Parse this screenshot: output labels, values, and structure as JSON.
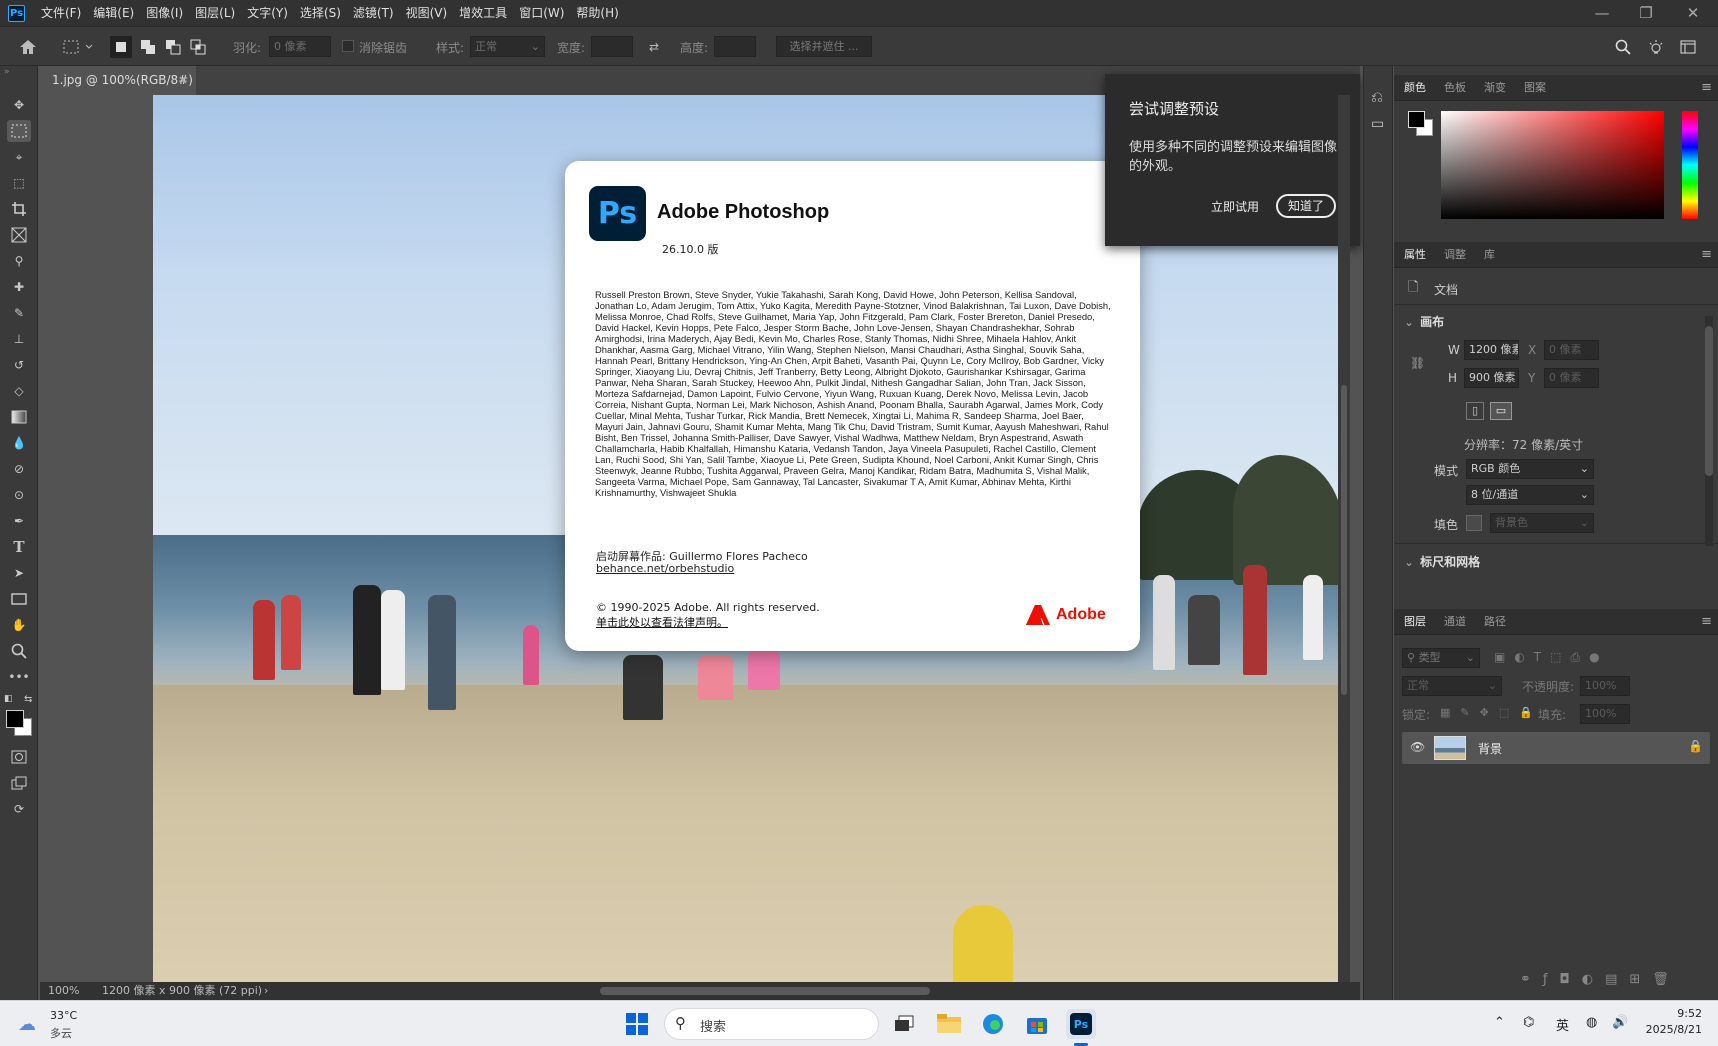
{
  "app": {
    "icon_text": "Ps"
  },
  "menu": [
    "文件(F)",
    "编辑(E)",
    "图像(I)",
    "图层(L)",
    "文字(Y)",
    "选择(S)",
    "滤镜(T)",
    "视图(V)",
    "增效工具",
    "窗口(W)",
    "帮助(H)"
  ],
  "options": {
    "feather_label": "羽化:",
    "feather_value": "0 像素",
    "antialias": "消除锯齿",
    "style_label": "样式:",
    "style_value": "正常",
    "width_label": "宽度:",
    "height_label": "高度:",
    "select_mask": "选择并遮住 ..."
  },
  "document": {
    "tab": "1.jpg @ 100%(RGB/8#)",
    "close": "×"
  },
  "status": {
    "zoom": "100%",
    "info": "1200 像素 x 900 像素 (72 ppi)",
    "arrow": "›"
  },
  "popup": {
    "title": "尝试调整预设",
    "desc": "使用多种不同的调整预设来编辑图像的外观。",
    "try": "立即试用",
    "ok": "知道了"
  },
  "about": {
    "logo": "Ps",
    "title": "Adobe Photoshop",
    "version": "26.10.0 版",
    "credits": "Russell Preston Brown, Steve Snyder, Yukie Takahashi, Sarah Kong, David Howe, John Peterson, Kellisa Sandoval, Jonathan Lo, Adam Jerugim, Tom Attix, Yuko Kagita, Meredith Payne-Stotzner, Vinod Balakrishnan, Tai Luxon, Dave Dobish, Melissa Monroe, Chad Rolfs, Steve Guilhamet, Maria Yap, John Fitzgerald, Pam Clark, Foster Brereton, Daniel Presedo, David Hackel, Kevin Hopps, Pete Falco, Jesper Storm Bache, John Love-Jensen, Shayan Chandrashekhar, Sohrab Amirghodsi, Irina Maderych, Ajay Bedi, Kevin Mo, Charles Rose, Stanly Thomas, Nidhi Shree, Mihaela Hahlov, Ankit Dhankhar, Aasma Garg, Michael Vitrano, Yilin Wang, Stephen Nielson, Mansi Chaudhari, Astha Singhal, Souvik Saha, Hannah Pearl, Brittany Hendrickson, Ying-An Chen, Arpit Baheti, Vasanth Pai, Quynn Le, Cory McIlroy, Bob Gardner, Vicky Springer, Xiaoyang Liu, Devraj Chitnis, Jeff Tranberry, Betty Leong, Albright Djokoto, Gaurishankar Kshirsagar, Garima Panwar, Neha Sharan, Sarah Stuckey, Heewoo Ahn, Pulkit Jindal, Nithesh Gangadhar Salian, John Tran, Jack Sisson, Morteza Safdarnejad, Damon Lapoint, Fulvio Cervone, Yiyun Wang, Ruxuan Kuang, Derek Novo, Melissa Levin, Jacob Correia, Nishant Gupta, Norman Lei, Mark Nichoson, Ashish Anand, Poonam Bhalla, Saurabh Agarwal, James Mork, Cody Cuellar, Minal Mehta, Tushar Turkar, Rick Mandia, Brett Nemecek, Xingtai Li, Mahima R, Sandeep Sharma, Joel Baer, Mayuri Jain, Jahnavi Gouru, Shamit Kumar Mehta, Mang Tik Chu, David Tristram, Sumit Kumar, Aayush Maheshwari, Rahul Bisht, Ben Trissel, Johanna Smith-Palliser, Dave Sawyer, Vishal Wadhwa, Matthew Neldam, Bryn Aspestrand, Aswath Challamcharla, Habib Khalfallah, Himanshu Kataria, Vedansh Tandon, Jaya Vineela Pasupuleti, Rachel Castillo, Clement Lan, Ruchi Sood, Shi Yan, Salil Tambe, Xiaoyue Li, Pete Green, Sudipta Khound, Noel Carboni, Ankit Kumar Singh, Chris Steenwyk, Jeanne Rubbo, Tushita Aggarwal, Praveen Gelra, Manoj Kandikar, Ridam Batra, Madhumita S, Vishal Malik, Sangeeta Varma, Michael Pope, Sam Gannaway, Tal Lancaster, Sivakumar T A, Amit Kumar, Abhinav Mehta, Kirthi Krishnamurthy, Vishwajeet Shukla",
    "splash_label": "启动屏幕作品:",
    "splash_artist": "Guillermo Flores Pacheco",
    "splash_link": "behance.net/orbehstudio",
    "copyright": "© 1990-2025 Adobe. All rights reserved.",
    "legal": "单击此处以查看法律声明。",
    "brand": "Adobe"
  },
  "panels": {
    "color_tabs": [
      "颜色",
      "色板",
      "渐变",
      "图案"
    ],
    "prop_tabs": [
      "属性",
      "调整",
      "库"
    ],
    "doc_label": "文档",
    "canvas": {
      "heading": "画布",
      "w_label": "W",
      "w_value": "1200 像素",
      "h_label": "H",
      "h_value": "900 像素",
      "x_label": "X",
      "x_value": "0 像素",
      "y_label": "Y",
      "y_value": "0 像素",
      "resolution": "分辨率：72 像素/英寸",
      "mode_label": "模式",
      "mode_value": "RGB 颜色",
      "depth_value": "8 位/通道",
      "fill_label": "填色",
      "fill_value": "背景色"
    },
    "rulers_heading": "标尺和网格",
    "layer_tabs": [
      "图层",
      "通道",
      "路径"
    ],
    "layer_kind": "类型",
    "blend_mode": "正常",
    "opacity_label": "不透明度:",
    "opacity_value": "100%",
    "lock_label": "锁定:",
    "fill2_label": "填充:",
    "fill2_value": "100%",
    "layer_name": "背景"
  },
  "taskbar": {
    "weather_temp": "33°C",
    "weather_desc": "多云",
    "search": "搜索",
    "ime": "英",
    "time": "9:52",
    "date": "2025/8/21"
  },
  "colors": {
    "accent": "#31a8ff",
    "adobe_red": "#eb1000"
  }
}
